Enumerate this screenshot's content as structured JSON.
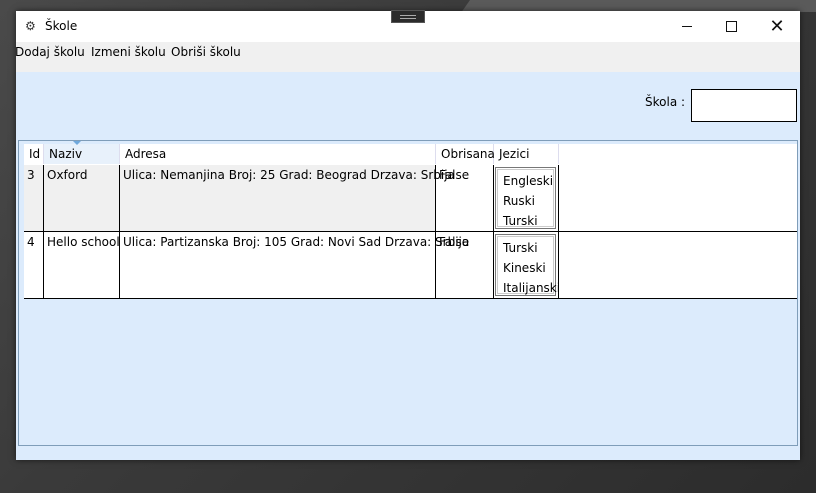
{
  "window": {
    "title": "Škole",
    "controls": {
      "minimize": "minimize",
      "maximize": "maximize",
      "close": "close"
    }
  },
  "menu": [
    {
      "label": "Dodaj školu"
    },
    {
      "label": "Izmeni školu"
    },
    {
      "label": "Obriši školu"
    }
  ],
  "search": {
    "label": "Škola :",
    "value": ""
  },
  "table": {
    "columns": [
      "Id",
      "Naziv",
      "Adresa",
      "Obrisana",
      "Jezici"
    ],
    "sorted_column": "Naziv",
    "rows": [
      {
        "id": "3",
        "naziv": "Oxford",
        "adresa": "Ulica: Nemanjina Broj: 25 Grad: Beograd Drzava: Srbija",
        "obrisana": "False",
        "jezici": [
          "Engleski",
          "Ruski",
          "Turski"
        ]
      },
      {
        "id": "4",
        "naziv": "Hello school",
        "adresa": "Ulica: Partizanska Broj: 105 Grad: Novi Sad Drzava: Srbija",
        "obrisana": "False",
        "jezici": [
          "Turski",
          "Kineski",
          "Italijanski"
        ]
      }
    ]
  },
  "colors": {
    "window_bg": "#dcebfc",
    "selected_header": "#e8f1fb",
    "grid_border": "#7f9db9"
  },
  "icons": {
    "app": "gear-icon"
  }
}
